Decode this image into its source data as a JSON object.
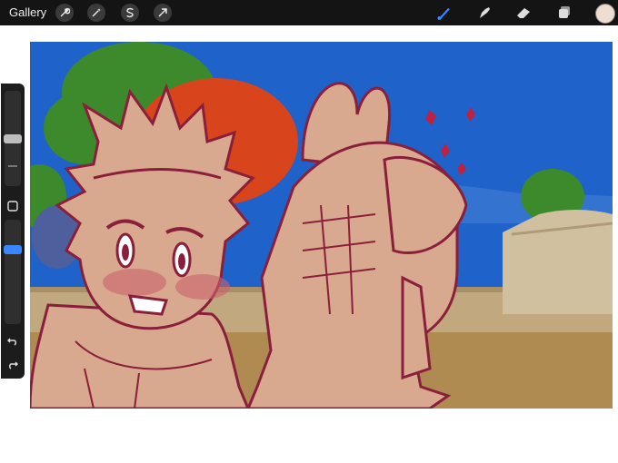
{
  "toolbar": {
    "gallery_label": "Gallery",
    "left_tools": [
      {
        "name": "actions",
        "icon": "wrench-icon"
      },
      {
        "name": "adjustments",
        "icon": "magic-wand-icon"
      },
      {
        "name": "selection",
        "icon": "selection-s-icon"
      },
      {
        "name": "transform",
        "icon": "arrow-cursor-icon"
      }
    ],
    "right_tools": [
      {
        "name": "brush",
        "icon": "brush-icon",
        "active": true
      },
      {
        "name": "smudge",
        "icon": "smudge-icon"
      },
      {
        "name": "eraser",
        "icon": "eraser-icon"
      },
      {
        "name": "layers",
        "icon": "layers-icon"
      }
    ],
    "active_color": "#f0ddd2",
    "accent": "#3a86ff"
  },
  "sidebar": {
    "brush_size_level": 0.2,
    "opacity_level": 0.3,
    "modify_button": "square-icon",
    "undo": "undo-icon",
    "redo": "redo-icon"
  },
  "colors": {
    "sky": "#1f62c9",
    "skin": "#d9a98f",
    "line": "#8a1f3c",
    "blush": "#c9626a",
    "hair_red": "#d8451d",
    "tree": "#3d8a2c",
    "wall": "#c2a87f"
  }
}
